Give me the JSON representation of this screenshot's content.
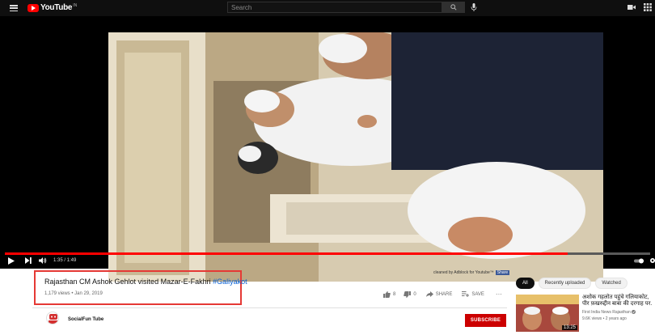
{
  "header": {
    "logo_text": "YouTube",
    "logo_sup": "IN",
    "search_placeholder": "Search",
    "icons": [
      "menu-icon",
      "search-icon",
      "mic-icon",
      "video-camera-icon",
      "apps-icon"
    ]
  },
  "player": {
    "time": "1:35 / 1:49",
    "progress": 0.872,
    "adblock_text": "cleaned by Adblock for Youtube™",
    "adblock_share": "Share"
  },
  "video": {
    "title": "Rajasthan CM Ashok Gehlot visited Mazar-E-Fakhri",
    "hashtag": "#Galiyakot",
    "meta": "1,179 views • Jan 29, 2019",
    "likes": "8",
    "dislikes": "0",
    "share_label": "SHARE",
    "save_label": "SAVE",
    "more_label": "···"
  },
  "channel": {
    "name": "SocialFun Tube",
    "subscribe_label": "SUBSCRIBE"
  },
  "chips": [
    "All",
    "Recently uploaded",
    "Watched"
  ],
  "recommendations": [
    {
      "title": "अशोक गहलोत पहुंचे गलियाकोट, पीर फ़खरुद्दीन बाबा की दरगाह पर.",
      "channel": "First India News Rajasthan",
      "views": "9.6K views • 2 years ago",
      "duration": "13:25"
    }
  ],
  "colors": {
    "accent_red": "#ff0000",
    "subscribe_red": "#cc0000",
    "hashtag_blue": "#065fd4",
    "highlight_box": "#e53935"
  }
}
